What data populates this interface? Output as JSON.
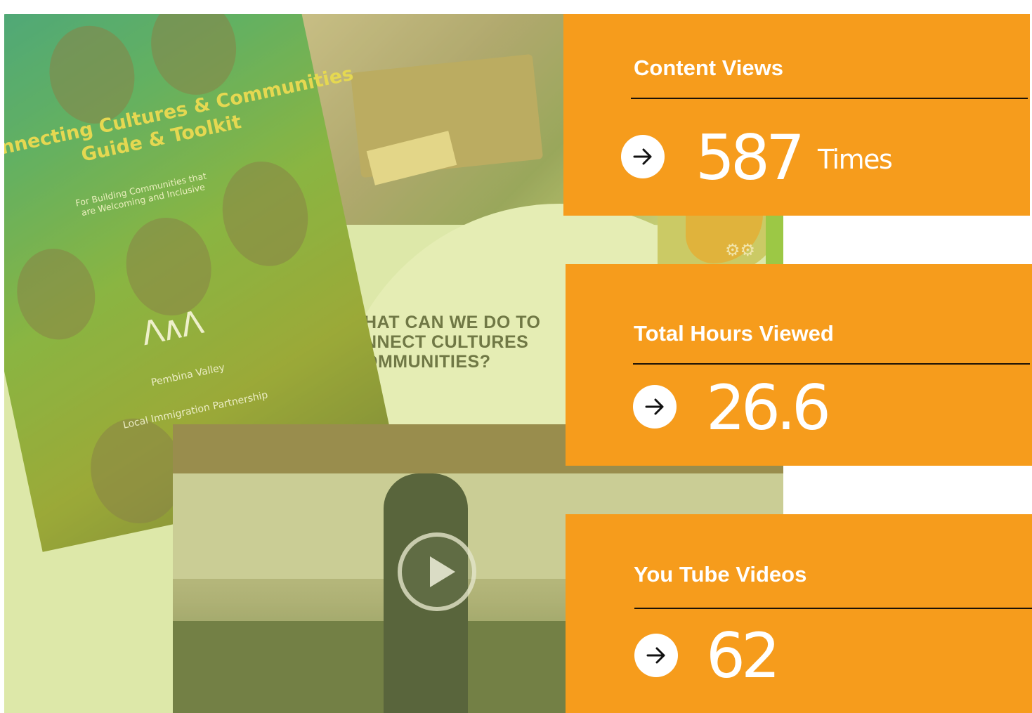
{
  "collage": {
    "guide_title_line1": "nnecting Cultures & Communities",
    "guide_title_line2": "Guide & Toolkit",
    "guide_subtitle": "For Building Communities that\nare Welcoming and Inclusive",
    "org_name_line1": "Pembina Valley",
    "org_name_line2": "Local Immigration Partnership",
    "slide_heading": "HAT CAN WE DO TO\nNNECT CULTURES\nOMMUNITIES?"
  },
  "stats": [
    {
      "label": "Content Views",
      "value": "587",
      "unit": "Times"
    },
    {
      "label": "Total Hours Viewed",
      "value": "26.6",
      "unit": ""
    },
    {
      "label": "You Tube Videos",
      "value": "62",
      "unit": ""
    }
  ],
  "colors": {
    "card_orange": "#f69c1c",
    "divider": "#1c1206",
    "text_white": "#ffffff"
  },
  "icons": {
    "stat_arrow": "arrow-right-icon",
    "video_play": "play-icon"
  }
}
